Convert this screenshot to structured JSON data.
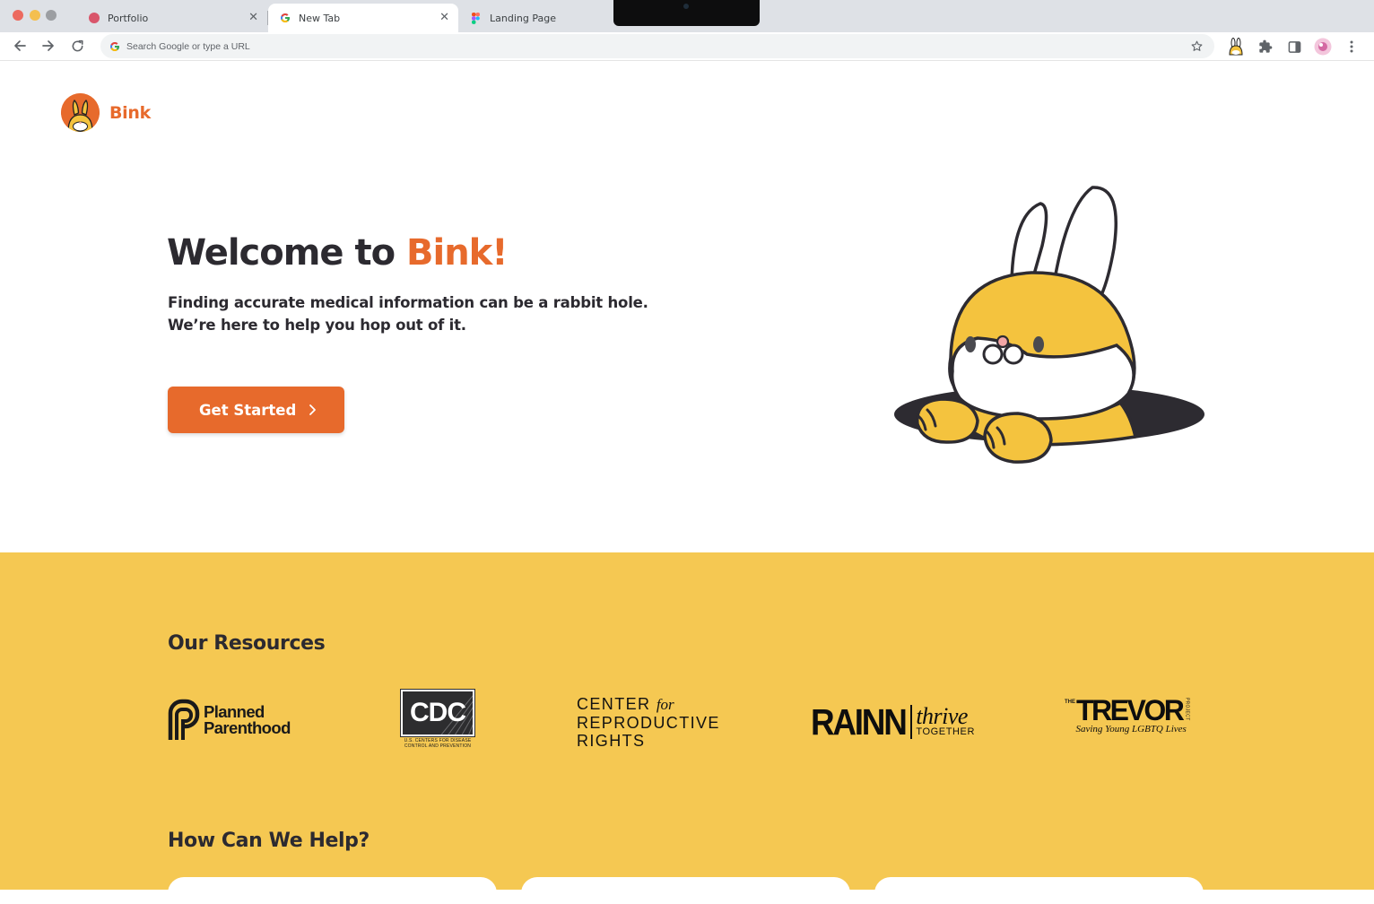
{
  "browser": {
    "tabs": [
      {
        "title": "Portfolio",
        "favicon": "portfolio-favicon"
      },
      {
        "title": "New Tab",
        "favicon": "google-icon",
        "active": true
      },
      {
        "title": "Landing Page",
        "favicon": "figma-icon"
      }
    ],
    "close_glyph": "✕",
    "omnibox": {
      "placeholder": "Search Google or type a URL",
      "value": ""
    }
  },
  "site": {
    "brand": "Bink",
    "hero": {
      "title_prefix": "Welcome to ",
      "title_accent": "Bink!",
      "subtitle_line1": "Finding accurate medical information can be a rabbit hole.",
      "subtitle_line2": "We’re here to help you hop out of it.",
      "cta_label": "Get Started"
    },
    "resources": {
      "title": "Our Resources",
      "partners": {
        "planned_parenthood": {
          "line1": "Planned",
          "line2": "Parenthood"
        },
        "cdc": {
          "mark": "CDC",
          "line1": "U.S. CENTERS FOR DISEASE",
          "line2": "CONTROL AND PREVENTION"
        },
        "center_repro": {
          "word1": "CENTER",
          "for": "for",
          "line2": "REPRODUCTIVE",
          "line3": "RIGHTS"
        },
        "rainn": {
          "mark": "RAINN",
          "thrive": "thrive",
          "together": "TOGETHER"
        },
        "trevor": {
          "the": "THE",
          "word": "TREVOR",
          "project": "PROJECT",
          "tagline": "Saving Young LGBTQ Lives"
        }
      }
    },
    "help": {
      "title": "How Can We Help?"
    }
  },
  "colors": {
    "accent": "#e76a2c",
    "resources_bg": "#f5c852",
    "text_dark": "#2c2a30",
    "bunny_yellow": "#f4c33e"
  }
}
